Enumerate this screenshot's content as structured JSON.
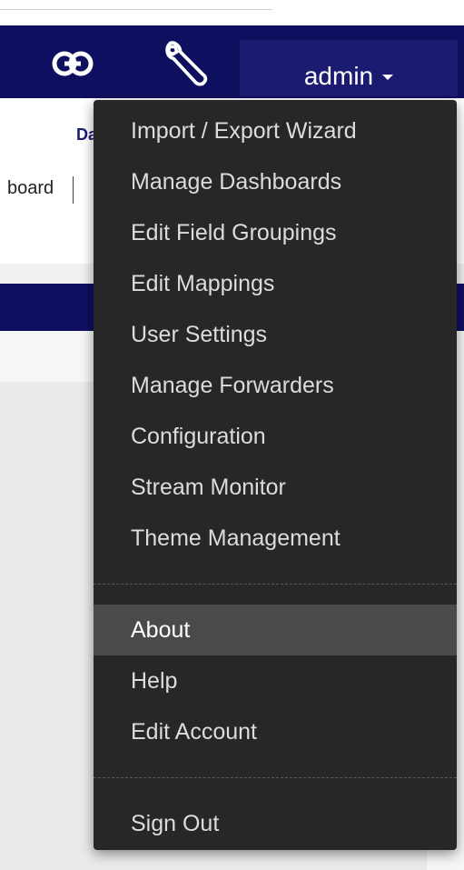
{
  "navbar": {
    "link_icon": "link-icon",
    "settings_icon": "wrench-icon",
    "user_label": "admin",
    "caret_icon": "caret-down-icon"
  },
  "background": {
    "tab_partial": "Da",
    "breadcrumb_partial": "board"
  },
  "menu": {
    "groups": [
      {
        "items": [
          {
            "label": "Import / Export Wizard"
          },
          {
            "label": "Manage Dashboards"
          },
          {
            "label": "Edit Field Groupings"
          },
          {
            "label": "Edit Mappings"
          },
          {
            "label": "User Settings"
          },
          {
            "label": "Manage Forwarders"
          },
          {
            "label": "Configuration"
          },
          {
            "label": "Stream Monitor"
          },
          {
            "label": "Theme Management"
          }
        ]
      },
      {
        "items": [
          {
            "label": "About",
            "active": true
          },
          {
            "label": "Help"
          },
          {
            "label": "Edit Account"
          }
        ]
      },
      {
        "items": [
          {
            "label": "Sign Out"
          }
        ]
      }
    ]
  },
  "colors": {
    "navbar_bg": "#0f0f5f",
    "menu_bg": "#272727",
    "menu_active_bg": "#4a4a4a",
    "menu_text": "#dcdcdc"
  }
}
